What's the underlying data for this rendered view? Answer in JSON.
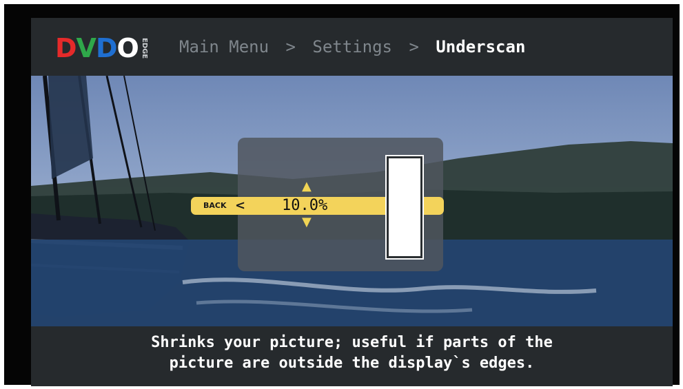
{
  "header": {
    "logo": {
      "letters": [
        "D",
        "V",
        "D",
        "O"
      ],
      "model": "EDGE"
    },
    "breadcrumb": [
      "Main Menu",
      "Settings",
      "Underscan"
    ],
    "separator": ">"
  },
  "control": {
    "back_label": "BACK",
    "back_arrow": "<",
    "value": "10.0%",
    "up_icon": "chevron-up",
    "down_icon": "chevron-down",
    "meter_icon": "underscan-meter"
  },
  "description": {
    "line1": "Shrinks your picture; useful if parts of the",
    "line2": "picture are outside the display`s edges."
  }
}
